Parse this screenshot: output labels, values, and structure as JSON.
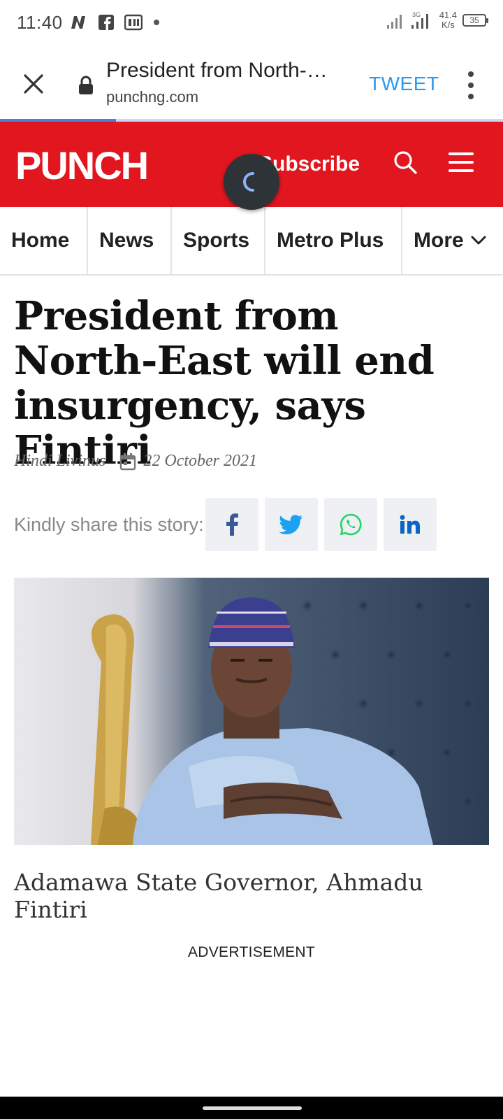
{
  "status_bar": {
    "time": "11:40",
    "net_speed_value": "41.4",
    "net_speed_unit": "K/s",
    "battery_level": "35",
    "signal_label": "3G"
  },
  "browser": {
    "page_title": "President from North-…",
    "domain": "punchng.com",
    "tweet_label": "TWEET",
    "load_progress": 0.23
  },
  "site_header": {
    "logo_text": "PUNCH",
    "subscribe_label": "Subscribe",
    "brand_color": "#e2161f"
  },
  "nav": {
    "items": [
      {
        "label": "Home"
      },
      {
        "label": "News"
      },
      {
        "label": "Sports"
      },
      {
        "label": "Metro Plus"
      },
      {
        "label": "More"
      }
    ]
  },
  "article": {
    "headline": "President from North-East will end insurgency, says Fintiri",
    "author": "Hindi Livinus",
    "date": "22 October 2021",
    "share_label": "Kindly share this story:",
    "share_buttons": [
      {
        "network": "facebook",
        "icon": "facebook-icon",
        "color": "#3b5998"
      },
      {
        "network": "twitter",
        "icon": "twitter-icon",
        "color": "#1da1f2"
      },
      {
        "network": "whatsapp",
        "icon": "whatsapp-icon",
        "color": "#25d366"
      },
      {
        "network": "linkedin",
        "icon": "linkedin-icon",
        "color": "#0a66c2"
      }
    ],
    "image_caption": "Adamawa State Governor, Ahmadu Fintiri",
    "advertisement_label": "ADVERTISEMENT"
  }
}
